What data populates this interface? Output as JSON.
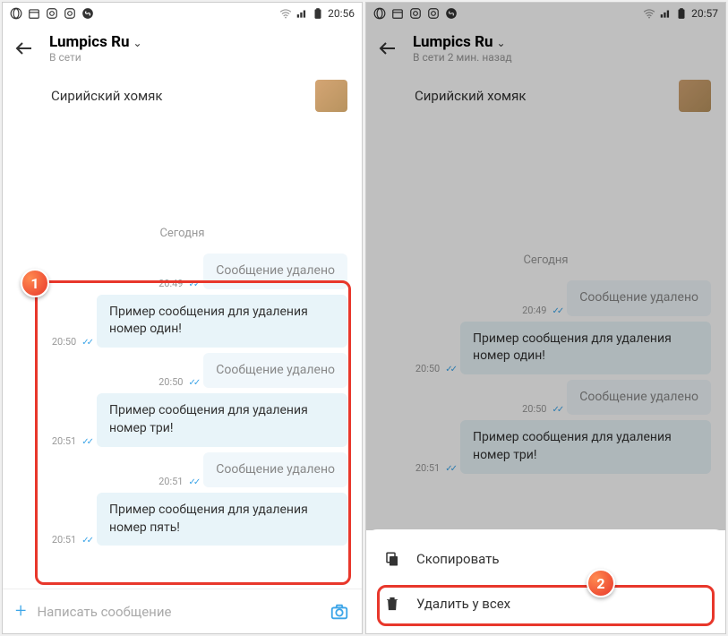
{
  "left": {
    "status_time": "20:56",
    "header_title": "Lumpics Ru",
    "header_status": "В сети",
    "pinned": "Сирийский хомяк",
    "date": "Сегодня",
    "messages": [
      {
        "time": "20:49",
        "text": "Сообщение удалено",
        "deleted": true
      },
      {
        "time": "20:50",
        "text": "Пример сообщения для удаления номер один!",
        "deleted": false
      },
      {
        "time": "20:50",
        "text": "Сообщение удалено",
        "deleted": true
      },
      {
        "time": "20:51",
        "text": "Пример сообщения для удаления номер три!",
        "deleted": false
      },
      {
        "time": "20:51",
        "text": "Сообщение удалено",
        "deleted": true
      },
      {
        "time": "20:51",
        "text": "Пример сообщения для удаления номер пять!",
        "deleted": false
      }
    ],
    "input_placeholder": "Написать сообщение",
    "badge": "1"
  },
  "right": {
    "status_time": "20:57",
    "header_title": "Lumpics Ru",
    "header_status": "В сети 2 мин. назад",
    "pinned": "Сирийский хомяк",
    "date": "Сегодня",
    "messages": [
      {
        "time": "20:49",
        "text": "Сообщение удалено",
        "deleted": true
      },
      {
        "time": "20:50",
        "text": "Пример сообщения для удаления номер один!",
        "deleted": false
      },
      {
        "time": "20:50",
        "text": "Сообщение удалено",
        "deleted": true
      },
      {
        "time": "20:51",
        "text": "Пример сообщения для удаления номер три!",
        "deleted": false
      }
    ],
    "menu": {
      "copy": "Скопировать",
      "delete": "Удалить у всех"
    },
    "badge": "2"
  }
}
